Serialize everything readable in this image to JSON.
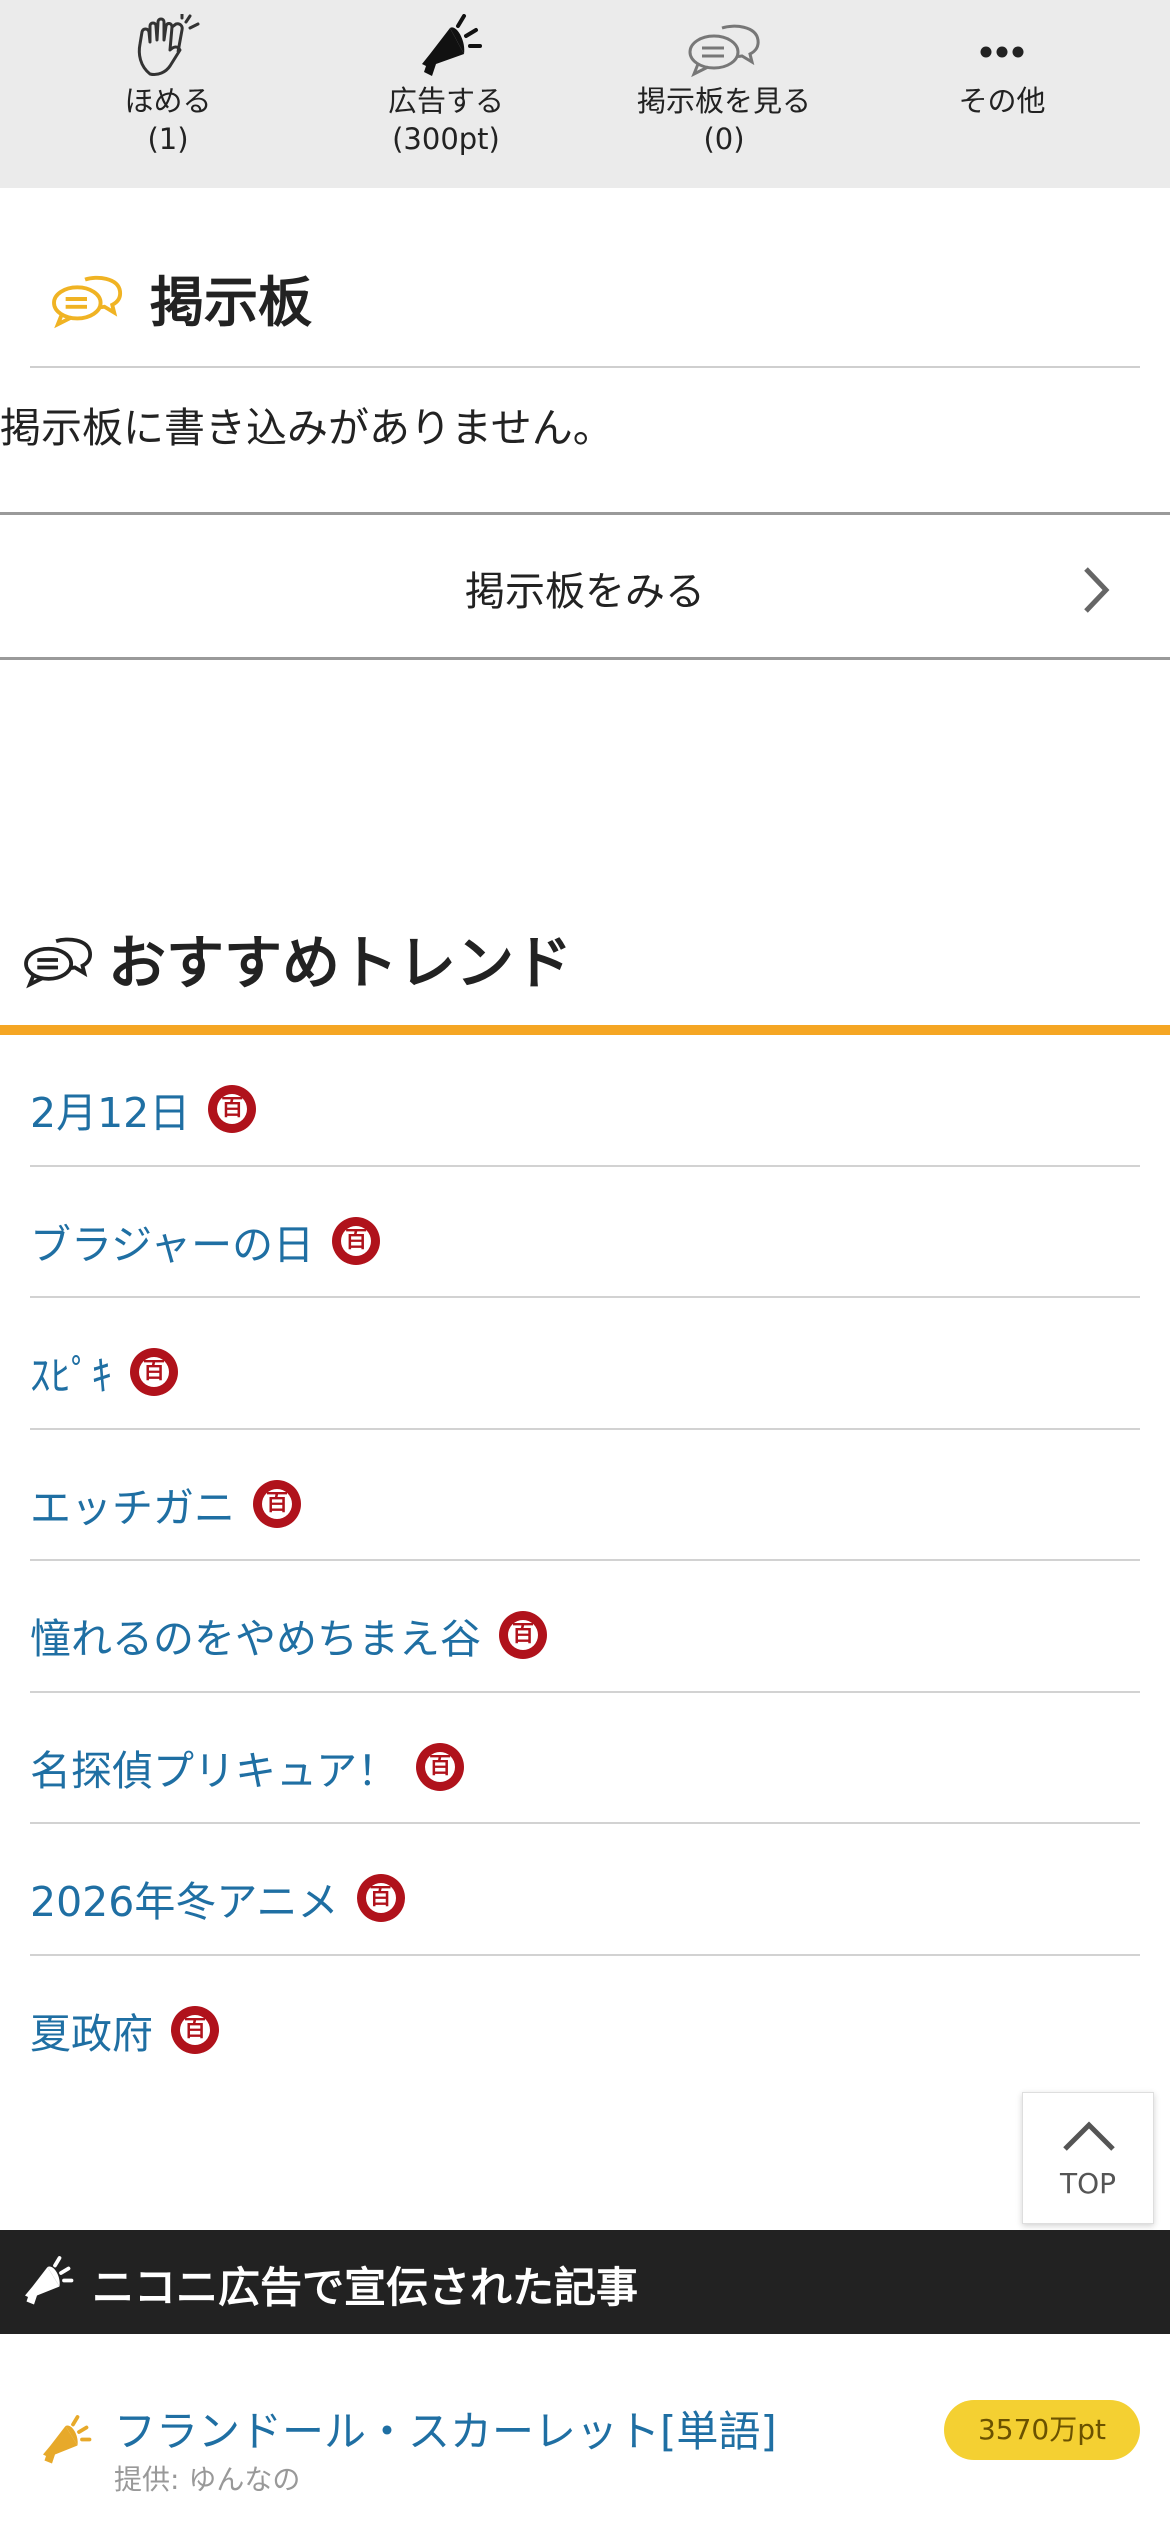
{
  "actionbar": {
    "items": [
      {
        "icon": "clap-hands-icon",
        "label": "ほめる",
        "count": "(1)"
      },
      {
        "icon": "megaphone-icon",
        "label": "広告する",
        "count": "(300pt)"
      },
      {
        "icon": "chat-bubbles-icon",
        "label": "掲示板を見る",
        "count": "(0)"
      },
      {
        "icon": "more-dots-icon",
        "label": "その他",
        "count": ""
      }
    ]
  },
  "board": {
    "title": "掲示板",
    "empty_message": "掲示板に書き込みがありません。",
    "view_link": "掲示板をみる"
  },
  "trends": {
    "title": "おすすめトレンド",
    "badge_char": "百",
    "items": [
      "2月12日",
      "ブラジャーの日",
      "ｽﾋﾟｷ",
      "エッチガニ",
      "憧れるのをやめちまえ谷",
      "名探偵プリキュア！",
      "2026年冬アニメ",
      "夏政府"
    ]
  },
  "top_button": {
    "label": "TOP"
  },
  "ads": {
    "title": "ニコニ広告で宣伝された記事",
    "items": [
      {
        "title": "フランドール・スカーレット[単語]",
        "sponsor": "提供: ゆんなの",
        "points": "3570万pt"
      }
    ]
  },
  "colors": {
    "accent_orange": "#f5a623",
    "link_blue": "#1f6fa3",
    "badge_red": "#b0121b",
    "points_yellow": "#f4d032",
    "dark_bar": "#222222"
  }
}
